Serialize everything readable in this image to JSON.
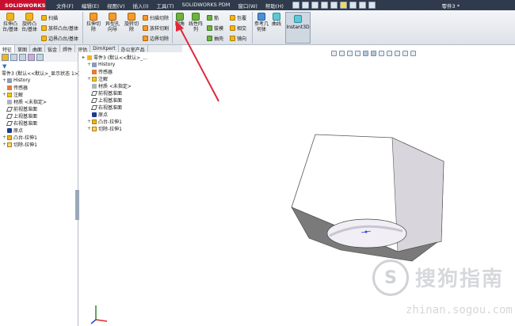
{
  "app": {
    "logo_text": "SOLIDWORKS",
    "document_title": "零件3 *"
  },
  "menu": [
    {
      "label": "文件(F)"
    },
    {
      "label": "编辑(E)"
    },
    {
      "label": "视图(V)"
    },
    {
      "label": "插入(I)"
    },
    {
      "label": "工具(T)"
    },
    {
      "label": "SOLIDWORKS PDM"
    },
    {
      "label": "窗口(W)"
    },
    {
      "label": "帮助(H)"
    }
  ],
  "ribbon": {
    "extrude_boss": "拉伸凸台/基体",
    "revolve_boss": "旋转凸台/基体",
    "sweep": "扫描",
    "loft": "放样凸台/基体",
    "boundary_boss": "边界凸台/基体",
    "extrude_cut": "拉伸切除",
    "hole_wizard": "异型孔向导",
    "revolve_cut": "旋转切除",
    "swept_cut": "扫描切除",
    "lofted_cut": "放样切割",
    "boundary_cut": "边界切除",
    "fillet": "圆角",
    "linear_pattern": "线性阵列",
    "rib": "筋",
    "draft": "拔模",
    "shell": "抽壳",
    "wrap": "包覆",
    "intersect": "相交",
    "mirror": "镜向",
    "reference_geometry": "参考几何体",
    "curves": "曲线",
    "instant3d": "Instant3D"
  },
  "command_tabs": [
    {
      "label": "特征"
    },
    {
      "label": "草图"
    },
    {
      "label": "曲面"
    },
    {
      "label": "钣金"
    },
    {
      "label": "焊件"
    },
    {
      "label": "评估"
    },
    {
      "label": "DimXpert"
    },
    {
      "label": "办公室产品"
    }
  ],
  "feature_tree": {
    "root": "零件3 (默认<<默认>_显示状态 1>)",
    "items": [
      {
        "label": "History"
      },
      {
        "label": "传感器"
      },
      {
        "label": "注解"
      },
      {
        "label": "材质 <未指定>"
      },
      {
        "label": "前视基准面"
      },
      {
        "label": "上视基准面"
      },
      {
        "label": "右视基准面"
      },
      {
        "label": "原点"
      },
      {
        "label": "凸台-拉伸1"
      },
      {
        "label": "切除-拉伸1"
      }
    ]
  },
  "viewport_tree": {
    "root": "零件3 (默认<<默认>_...",
    "items": [
      {
        "label": "History"
      },
      {
        "label": "传感器"
      },
      {
        "label": "注解"
      },
      {
        "label": "材质 <未指定>"
      },
      {
        "label": "前视基准面"
      },
      {
        "label": "上视基准面"
      },
      {
        "label": "右视基准面"
      },
      {
        "label": "原点"
      },
      {
        "label": "凸台-拉伸1"
      },
      {
        "label": "切除-拉伸1"
      }
    ]
  },
  "watermark": {
    "logo_char": "S",
    "text": "搜狗指南",
    "url": "zhinan.sogou.com"
  },
  "colors": {
    "arrow": "#e0283b",
    "title_bar": "#2f3b4c",
    "logo": "#c8102e",
    "model_face_top": "#ffffff",
    "model_face_right": "#d8d6dc",
    "model_face_bottom": "#7a7a7a"
  }
}
